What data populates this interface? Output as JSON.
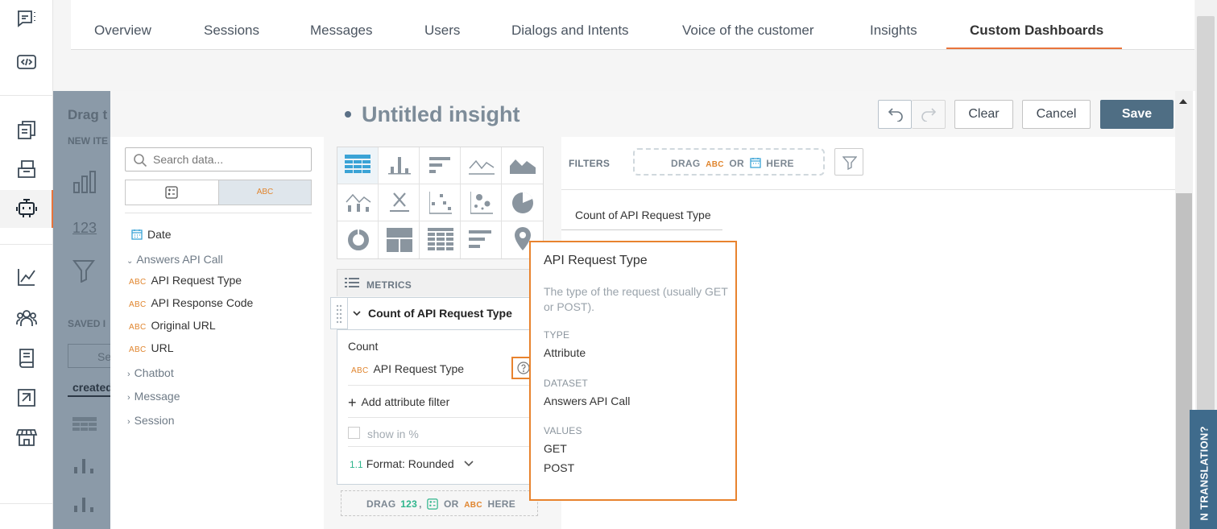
{
  "nav_tabs": [
    {
      "label": "Overview"
    },
    {
      "label": "Sessions"
    },
    {
      "label": "Messages"
    },
    {
      "label": "Users"
    },
    {
      "label": "Dialogs and Intents"
    },
    {
      "label": "Voice of the customer"
    },
    {
      "label": "Insights"
    },
    {
      "label": "Custom Dashboards"
    }
  ],
  "active_tab": "Custom Dashboards",
  "rail_icons": [
    "chat-settings-icon",
    "code-window-icon",
    "copy-docs-icon",
    "inbox-icon",
    "bot-icon",
    "analytics-line-icon",
    "users-icon",
    "book-icon",
    "dashboard-export-icon",
    "store-icon"
  ],
  "background": {
    "drag_heading": "Drag t",
    "new_items_label": "NEW ITE",
    "saved_label": "SAVED I",
    "search_partial": "Se",
    "created_tab": "created"
  },
  "data_panel": {
    "search_placeholder": "Search data...",
    "toggle_abc": "ABC",
    "items": [
      {
        "type": "date",
        "label": "Date"
      },
      {
        "type": "group-open",
        "label": "Answers API Call"
      },
      {
        "type": "abc",
        "label": "API Request Type"
      },
      {
        "type": "abc",
        "label": "API Response Code"
      },
      {
        "type": "abc",
        "label": "Original URL"
      },
      {
        "type": "abc",
        "label": "URL"
      },
      {
        "type": "group",
        "label": "Chatbot"
      },
      {
        "type": "group",
        "label": "Message"
      },
      {
        "type": "group",
        "label": "Session"
      }
    ]
  },
  "header": {
    "title": "Untitled insight",
    "clear_label": "Clear",
    "cancel_label": "Cancel",
    "save_label": "Save"
  },
  "chart_types": [
    "table",
    "column",
    "bar",
    "line",
    "area",
    "combo",
    "headline",
    "scatter",
    "bubble",
    "pie",
    "donut",
    "treemap",
    "heatmap",
    "bullet",
    "geo"
  ],
  "metrics": {
    "section_label": "METRICS",
    "metric_title": "Count of API Request Type",
    "aggregation": "Count",
    "attribute_abc": "ABC",
    "attribute": "API Request Type",
    "add_filter": "Add attribute filter",
    "show_percent": "show in %",
    "format_prefix": "1.1",
    "format_label": "Format: Rounded",
    "drop_zone": {
      "drag": "DRAG",
      "num": "123",
      "comma": ",",
      "or": "OR",
      "abc": "ABC",
      "here": "HERE"
    }
  },
  "filters": {
    "label": "FILTERS",
    "drop": {
      "drag": "DRAG",
      "abc": "ABC",
      "or": "OR",
      "here": "HERE"
    }
  },
  "table_column_header": "Count of API Request Type",
  "tooltip": {
    "title": "API Request Type",
    "description": "The type of the request (usually GET or POST).",
    "type_label": "TYPE",
    "type_value": "Attribute",
    "dataset_label": "DATASET",
    "dataset_value": "Answers API Call",
    "values_label": "VALUES",
    "values": [
      "GET",
      "POST"
    ]
  },
  "translation_tab": "N TRANSLATION?",
  "colors": {
    "accent": "#e8743b",
    "save": "#4f6e84",
    "abc_orange": "#e0852e"
  }
}
